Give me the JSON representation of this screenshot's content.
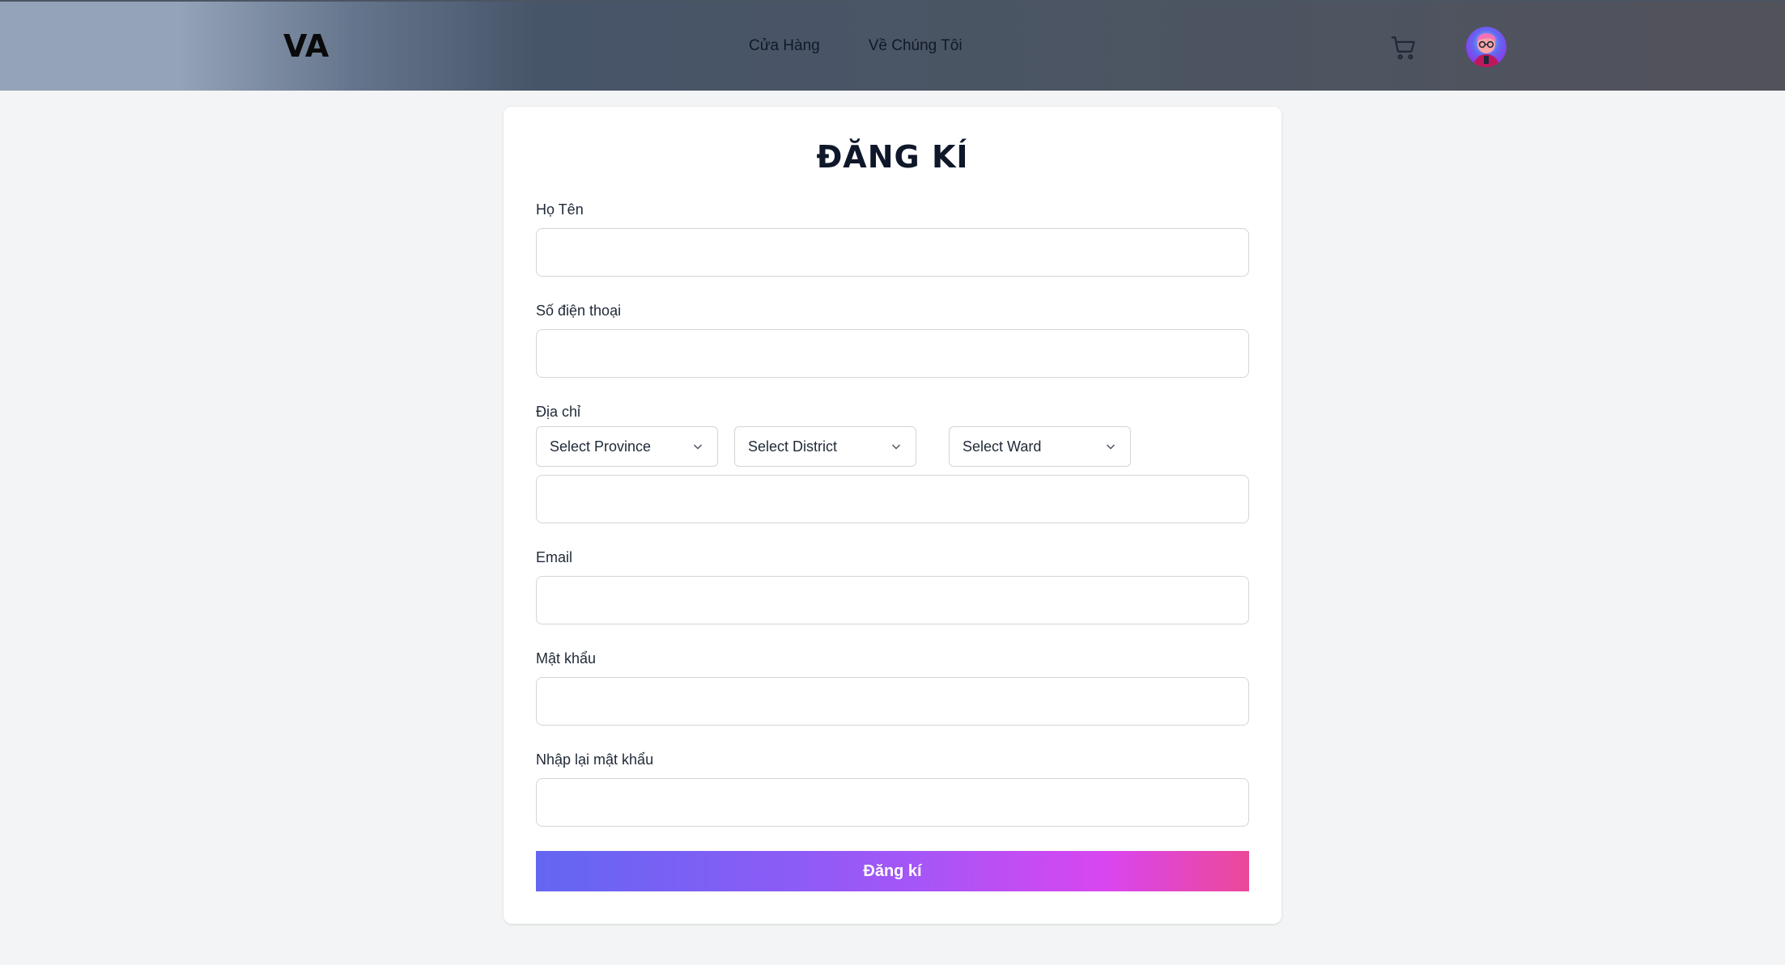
{
  "header": {
    "logo_text": "VA",
    "nav": [
      {
        "label": "Cửa Hàng"
      },
      {
        "label": "Về Chúng Tôi"
      }
    ]
  },
  "form": {
    "title": "ĐĂNG KÍ",
    "fullname_label": "Họ Tên",
    "fullname_value": "",
    "phone_label": "Số điện thoại",
    "phone_value": "",
    "address_label": "Địa chỉ",
    "province": {
      "selected": "Select Province"
    },
    "district": {
      "selected": "Select District"
    },
    "ward": {
      "selected": "Select Ward"
    },
    "street_value": "",
    "email_label": "Email",
    "email_value": "",
    "password_label": "Mật khẩu",
    "password_value": "",
    "confirm_label": "Nhập lại mật khẩu",
    "confirm_value": "",
    "submit_label": "Đăng kí"
  },
  "colors": {
    "accent_start": "#6366f1",
    "accent_end": "#ec4899"
  }
}
